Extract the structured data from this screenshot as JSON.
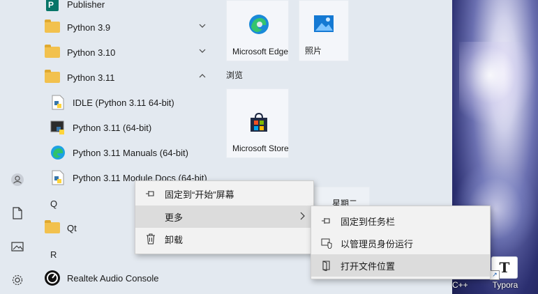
{
  "app_list": {
    "items": [
      {
        "label": "Publisher",
        "icon": "publisher-icon",
        "type": "app"
      },
      {
        "label": "Python 3.9",
        "icon": "folder-icon",
        "type": "folder",
        "chevron": "down"
      },
      {
        "label": "Python 3.10",
        "icon": "folder-icon",
        "type": "folder",
        "chevron": "down"
      },
      {
        "label": "Python 3.11",
        "icon": "folder-icon",
        "type": "folder",
        "chevron": "up"
      },
      {
        "label": "IDLE (Python 3.11 64-bit)",
        "icon": "idle-icon",
        "type": "sub"
      },
      {
        "label": "Python 3.11 (64-bit)",
        "icon": "python-console-icon",
        "type": "sub"
      },
      {
        "label": "Python 3.11 Manuals (64-bit)",
        "icon": "edge-icon",
        "type": "sub"
      },
      {
        "label": "Python 3.11 Module Docs (64-bit)",
        "icon": "module-docs-icon",
        "type": "sub"
      }
    ],
    "letter_q": "Q",
    "qt_label": "Qt",
    "letter_r": "R",
    "realtek_label": "Realtek Audio Console"
  },
  "tiles": {
    "edge_label": "Microsoft Edge",
    "photos_label": "照片",
    "group_browse": "浏览",
    "store_label": "Microsoft Store",
    "weekday_partial": "星期二"
  },
  "context_menu": {
    "items": [
      {
        "label": "固定到“开始”屏幕",
        "icon": "pin-icon"
      },
      {
        "label": "更多",
        "icon": "",
        "has_submenu": true
      },
      {
        "label": "卸载",
        "icon": "trash-icon"
      }
    ]
  },
  "submenu": {
    "items": [
      {
        "label": "固定到任务栏",
        "icon": "pin-icon"
      },
      {
        "label": "以管理员身份运行",
        "icon": "shield-icon"
      },
      {
        "label": "打开文件位置",
        "icon": "folder-open-icon"
      }
    ]
  },
  "desktop": {
    "typora_label": "Typora",
    "partial_label": "C++",
    "typora_glyph": "T"
  },
  "colors": {
    "start_bg": "#e3e9f0",
    "menu_bg": "#f2f2f2",
    "menu_highlight": "#dcdcdc",
    "folder": "#f2c14e",
    "accent": "#0078d4"
  }
}
